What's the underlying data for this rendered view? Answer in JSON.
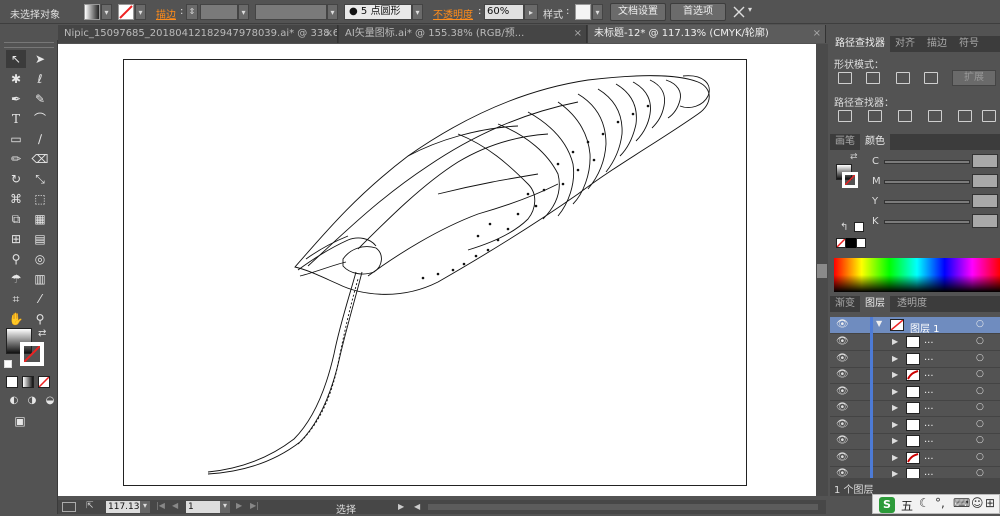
{
  "control_bar": {
    "selection_label": "未选择对象",
    "stroke_label": "描边",
    "stroke_colon": ":",
    "brush_value": "5",
    "brush_label": "点圆形",
    "opacity_label": "不透明度",
    "opacity_colon": ":",
    "opacity_value": "60%",
    "style_label": "样式",
    "style_colon": ":",
    "doc_setup_button": "文档设置",
    "preferences_button": "首选项"
  },
  "doc_tabs": [
    {
      "label": "Nipic_15097685_20180412182947978039.ai* @ 338.62% (RGB/预...",
      "close": "×"
    },
    {
      "label": "AI矢量图标.ai* @ 155.38% (RGB/预...",
      "close": "×"
    },
    {
      "label": "未标题-12* @ 117.13% (CMYK/轮廓)",
      "close": "×"
    }
  ],
  "pathfinder": {
    "tabs": [
      "路径查找器",
      "对齐",
      "描边",
      "符号"
    ],
    "shape_modes_label": "形状模式：",
    "pathfinders_label": "路径查找器：",
    "expand_button": "扩展"
  },
  "color_panel": {
    "tabs": [
      "画笔",
      "颜色"
    ],
    "channels": [
      "C",
      "M",
      "Y",
      "K"
    ]
  },
  "layers_panel": {
    "tabs": [
      "渐变",
      "图层",
      "透明度"
    ],
    "top_layer_name": "图层 1",
    "sublayer_name": "...",
    "sublayer_count": 9,
    "footer_count": "1 个图层"
  },
  "status_bar": {
    "zoom": "117.13",
    "page": "1",
    "tool_status": "选择"
  },
  "ime_bar": {
    "logo": "S",
    "mode": "五"
  },
  "colors": {
    "ui_bg": "#535353",
    "panel_dark": "#3c3c3c",
    "active_layer": "#6f8cbf",
    "layer_blue": "#4d7bd6",
    "stroke_accent": "#ff8c1a"
  }
}
